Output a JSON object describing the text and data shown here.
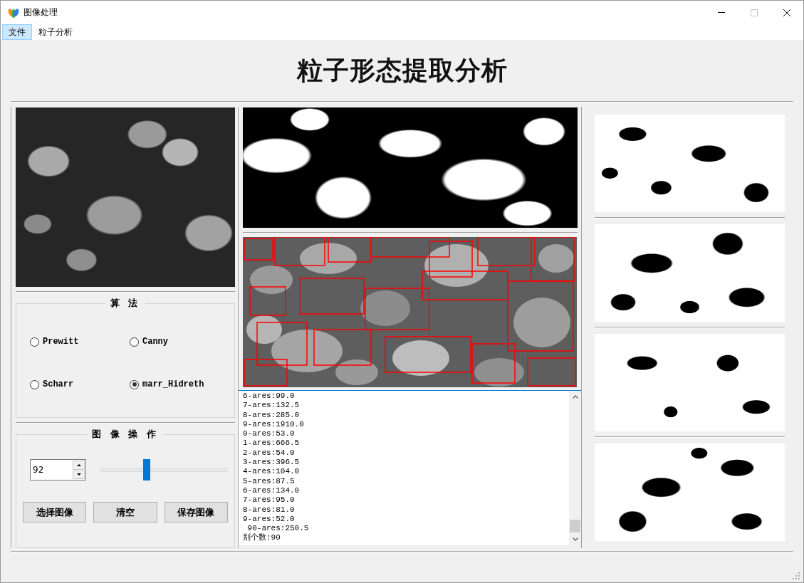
{
  "window": {
    "title": "图像处理",
    "controls": [
      {
        "kind": "minimize",
        "disabled": false
      },
      {
        "kind": "maximize",
        "disabled": true
      },
      {
        "kind": "close",
        "disabled": false
      }
    ]
  },
  "menu_bar": {
    "items": [
      {
        "label": "文件",
        "selected": true
      },
      {
        "label": "粒子分析",
        "selected": false
      }
    ]
  },
  "heading": "粒子形态提取分析",
  "algorithm_group": {
    "title": "算 法",
    "options": [
      {
        "label": "Prewitt",
        "selected": false
      },
      {
        "label": "Canny",
        "selected": false
      },
      {
        "label": "Scharr",
        "selected": false
      },
      {
        "label": "marr_Hidreth",
        "selected": true
      }
    ]
  },
  "image_operations_group": {
    "title": "图 像 操 作",
    "spin_box": {
      "value": "92"
    },
    "slider": {
      "level": 0.36
    },
    "buttons": [
      "选择图像",
      "清空",
      "保存图像"
    ]
  },
  "results_log": {
    "lines": [
      "6-ares:99.0",
      "7-ares:132.5",
      "8-ares:285.0",
      "9-ares:1910.0",
      "0-ares:53.0",
      "1-ares:666.5",
      "2-ares:54.0",
      "3-ares:396.5",
      "4-ares:104.0",
      "5-ares:87.5",
      "6-ares:134.0",
      "7-ares:95.0",
      "8-ares:81.0",
      "9-ares:52.0",
      " 90-ares:250.5",
      "别个数:90"
    ]
  }
}
